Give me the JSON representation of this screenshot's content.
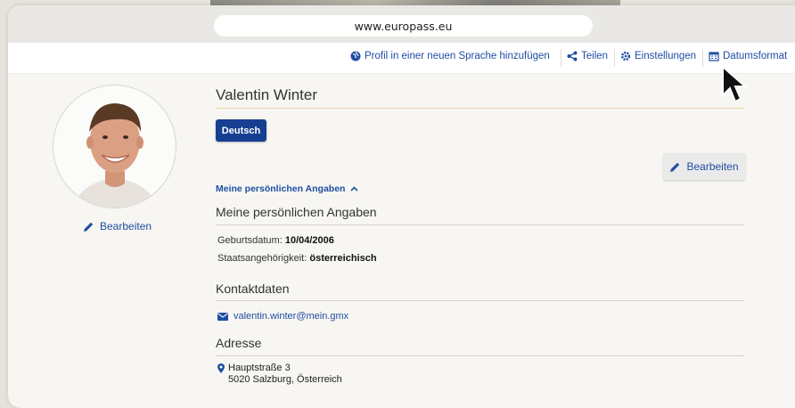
{
  "browser": {
    "url": "www.europass.eu"
  },
  "toolbar": {
    "add_language_label": "Profil in einer neuen Sprache hinzufügen",
    "share_label": "Teilen",
    "settings_label": "Einstellungen",
    "date_format_label": "Datumsformat"
  },
  "profile": {
    "edit_photo_label": "Bearbeiten",
    "name": "Valentin Winter",
    "language_button": "Deutsch",
    "edit_button": "Bearbeiten",
    "section_toggle": "Meine persönlichen Angaben",
    "section_title": "Meine persönlichen Angaben",
    "birth_label": "Geburtsdatum:",
    "birth_value": "10/04/2006",
    "nationality_label": "Staatsangehörigkeit:",
    "nationality_value": "österreichisch",
    "contact_title": "Kontaktdaten",
    "email": "valentin.winter@mein.gmx",
    "address_title": "Adresse",
    "address_line1": "Hauptstraße 3",
    "address_line2": "5020 Salzburg, Österreich"
  },
  "colors": {
    "accent": "#1f4ea3",
    "primary_button": "#163f91"
  }
}
